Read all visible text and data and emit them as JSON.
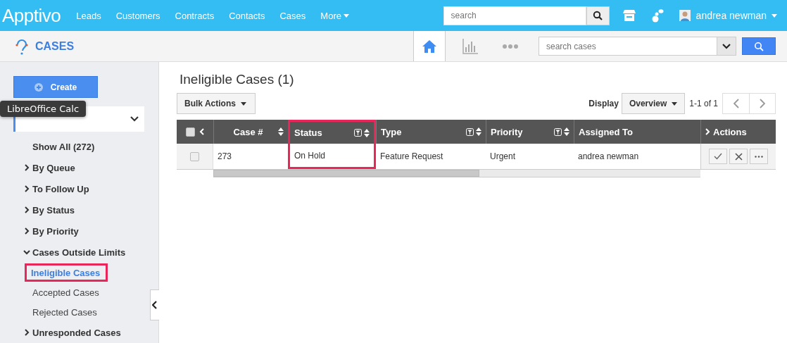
{
  "top_bar": {
    "logo": "Apptivo",
    "nav": [
      {
        "label": "Leads",
        "dropdown": false
      },
      {
        "label": "Customers",
        "dropdown": false
      },
      {
        "label": "Contracts",
        "dropdown": false
      },
      {
        "label": "Contacts",
        "dropdown": false
      },
      {
        "label": "Cases",
        "dropdown": false
      },
      {
        "label": "More",
        "dropdown": true
      }
    ],
    "search": {
      "placeholder": "search"
    },
    "user": "andrea newman"
  },
  "app_bar": {
    "title": "CASES",
    "views": [
      {
        "kind": "home",
        "selected": true
      },
      {
        "kind": "chart",
        "selected": false
      },
      {
        "kind": "more",
        "selected": false
      }
    ],
    "search": {
      "placeholder": "search cases"
    }
  },
  "sidebar": {
    "create": "Create",
    "tooltip": "LibreOffice Calc",
    "items": [
      {
        "label": "Show All (272)",
        "kind": "all"
      },
      {
        "label": "By Queue",
        "kind": "group",
        "expanded": false
      },
      {
        "label": "To Follow Up",
        "kind": "group",
        "expanded": false
      },
      {
        "label": "By Status",
        "kind": "group",
        "expanded": false
      },
      {
        "label": "By Priority",
        "kind": "group",
        "expanded": false
      },
      {
        "label": "Cases Outside Limits",
        "kind": "group",
        "expanded": true,
        "children": [
          {
            "label": "Ineligible Cases",
            "selected": true,
            "highlighted": true
          },
          {
            "label": "Accepted Cases",
            "selected": false,
            "highlighted": false
          },
          {
            "label": "Rejected Cases",
            "selected": false,
            "highlighted": false
          }
        ]
      },
      {
        "label": "Unresponded Cases",
        "kind": "group",
        "expanded": false
      }
    ]
  },
  "main": {
    "heading": "Ineligible Cases (1)",
    "bulk_actions": "Bulk Actions",
    "display_label": "Display",
    "display_value": "Overview",
    "pagination": "1-1 of 1",
    "table": {
      "select_all_checked": false,
      "columns": [
        {
          "label": "Case #",
          "filter": false,
          "sort": true,
          "highlighted": false
        },
        {
          "label": "Status",
          "filter": true,
          "sort": true,
          "highlighted": true
        },
        {
          "label": "Type",
          "filter": true,
          "sort": true,
          "highlighted": false
        },
        {
          "label": "Priority",
          "filter": true,
          "sort": true,
          "highlighted": false
        },
        {
          "label": "Assigned To",
          "filter": false,
          "sort": false,
          "highlighted": false
        }
      ],
      "actions_label": "Actions",
      "rows": [
        {
          "checked": false,
          "cells": [
            "273",
            "On Hold",
            "Feature Request",
            "Urgent",
            "andrea newman"
          ]
        }
      ]
    }
  }
}
